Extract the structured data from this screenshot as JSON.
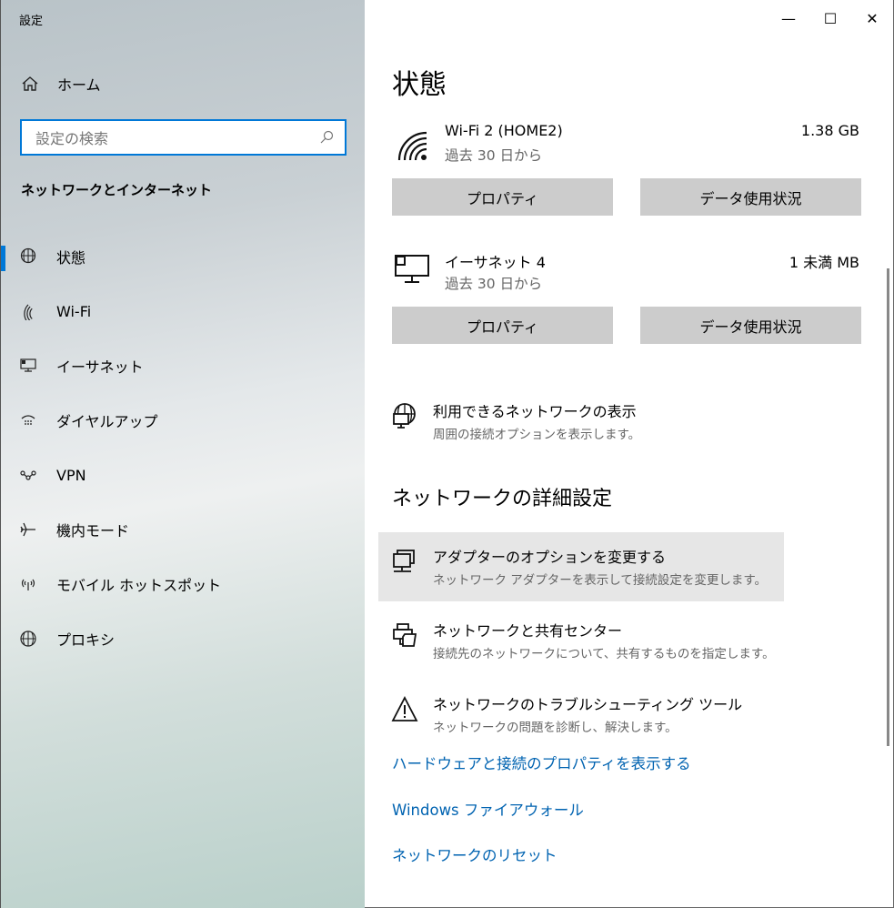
{
  "window": {
    "title": "設定",
    "minimize": "—",
    "maximize": "☐",
    "close": "✕"
  },
  "sidebar": {
    "home": "ホーム",
    "search_placeholder": "設定の検索",
    "section": "ネットワークとインターネット",
    "items": [
      {
        "label": "状態",
        "icon": "status-globe-icon"
      },
      {
        "label": "Wi-Fi",
        "icon": "wifi-icon"
      },
      {
        "label": "イーサネット",
        "icon": "ethernet-icon"
      },
      {
        "label": "ダイヤルアップ",
        "icon": "dialup-icon"
      },
      {
        "label": "VPN",
        "icon": "vpn-icon"
      },
      {
        "label": "機内モード",
        "icon": "airplane-icon"
      },
      {
        "label": "モバイル ホットスポット",
        "icon": "hotspot-icon"
      },
      {
        "label": "プロキシ",
        "icon": "globe-icon"
      }
    ]
  },
  "main": {
    "title": "状態",
    "connections": [
      {
        "name": "Wi-Fi 2 (HOME2)",
        "period": "過去 30 日から",
        "usage": "1.38 GB",
        "properties": "プロパティ",
        "data_usage": "データ使用状況"
      },
      {
        "name": "イーサネット 4",
        "period": "過去 30 日から",
        "usage": "1 未満 MB",
        "properties": "プロパティ",
        "data_usage": "データ使用状況"
      }
    ],
    "show_networks": {
      "title": "利用できるネットワークの表示",
      "desc": "周囲の接続オプションを表示します。"
    },
    "advanced_heading": "ネットワークの詳細設定",
    "options": [
      {
        "title": "アダプターのオプションを変更する",
        "desc": "ネットワーク アダプターを表示して接続設定を変更します。"
      },
      {
        "title": "ネットワークと共有センター",
        "desc": "接続先のネットワークについて、共有するものを指定します。"
      },
      {
        "title": "ネットワークのトラブルシューティング ツール",
        "desc": "ネットワークの問題を診断し、解決します。"
      }
    ],
    "links": [
      "ハードウェアと接続のプロパティを表示する",
      "Windows ファイアウォール",
      "ネットワークのリセット"
    ]
  },
  "colors": {
    "accent": "#0078d7",
    "link": "#0063b1",
    "button": "#cccccc",
    "hover": "#e6e6e6"
  }
}
